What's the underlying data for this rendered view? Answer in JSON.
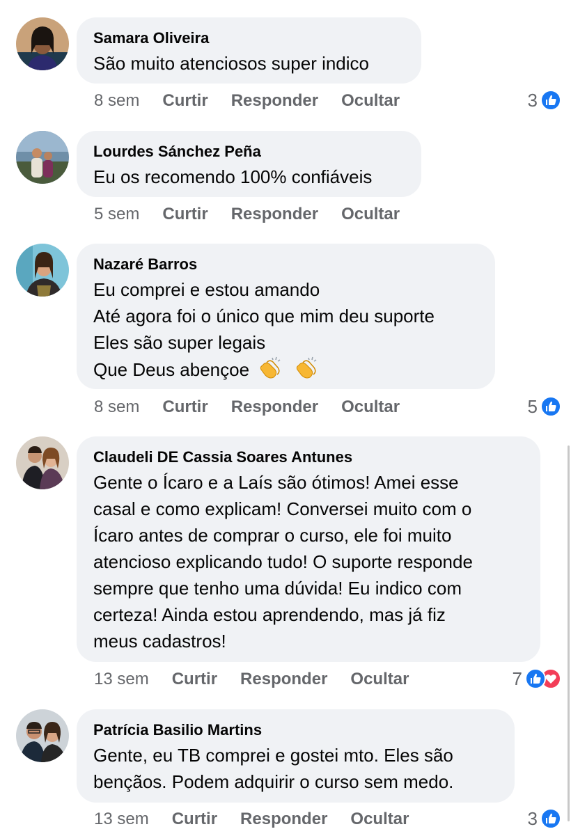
{
  "actions": {
    "like": "Curtir",
    "reply": "Responder",
    "hide": "Ocultar"
  },
  "colors": {
    "bubble": "#f0f2f5",
    "meta_text": "#65676b",
    "like_blue": "#1877f2",
    "love_red": "#f33e58"
  },
  "comments": [
    {
      "author": "Samara Oliveira",
      "lines": [
        "São muito atenciosos super indico"
      ],
      "time": "8 sem",
      "reaction_count": "3",
      "reactions": [
        "like-icon"
      ]
    },
    {
      "author": "Lourdes Sánchez Peña",
      "lines": [
        "Eu os recomendo 100% confiáveis"
      ],
      "time": "5 sem",
      "reaction_count": "",
      "reactions": []
    },
    {
      "author": "Nazaré Barros",
      "lines": [
        "Eu comprei e estou amando",
        "Até agora foi o único que mim deu suporte",
        "Eles são super legais",
        "Que Deus abençoe"
      ],
      "emoji": [
        "clapping-hands-icon",
        "clapping-hands-icon"
      ],
      "time": "8 sem",
      "reaction_count": "5",
      "reactions": [
        "like-icon"
      ]
    },
    {
      "author": "Claudeli DE Cassia Soares Antunes",
      "lines": [
        "Gente o Ícaro e a Laís são ótimos! Amei esse",
        "casal e como explicam! Conversei muito com o",
        "Ícaro antes de comprar o curso, ele foi muito",
        "atencioso explicando tudo! O suporte responde",
        "sempre que tenho uma dúvida! Eu indico com",
        "certeza! Ainda estou aprendendo, mas já fiz",
        "meus cadastros!"
      ],
      "time": "13 sem",
      "reaction_count": "7",
      "reactions": [
        "like-icon",
        "love-icon"
      ]
    },
    {
      "author": "Patrícia Basilio Martins",
      "lines": [
        "Gente, eu TB comprei e gostei mto. Eles são",
        "bençãos. Podem adquirir o curso sem medo."
      ],
      "time": "13 sem",
      "reaction_count": "3",
      "reactions": [
        "like-icon"
      ]
    }
  ]
}
